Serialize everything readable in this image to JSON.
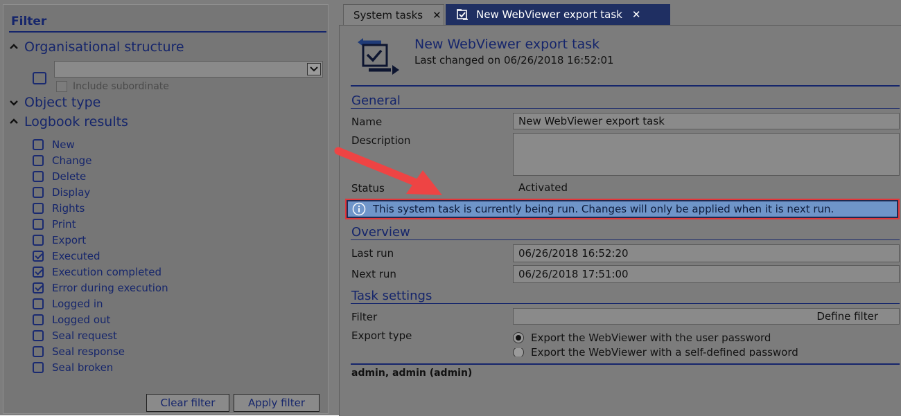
{
  "filter": {
    "title": "Filter",
    "org_structure": {
      "label": "Organisational structure",
      "include_subordinate": "Include subordinate"
    },
    "object_type": {
      "label": "Object type"
    },
    "logbook": {
      "label": "Logbook results",
      "items": [
        {
          "label": "New",
          "checked": false
        },
        {
          "label": "Change",
          "checked": false
        },
        {
          "label": "Delete",
          "checked": false
        },
        {
          "label": "Display",
          "checked": false
        },
        {
          "label": "Rights",
          "checked": false
        },
        {
          "label": "Print",
          "checked": false
        },
        {
          "label": "Export",
          "checked": false
        },
        {
          "label": "Executed",
          "checked": true
        },
        {
          "label": "Execution completed",
          "checked": true
        },
        {
          "label": "Error during execution",
          "checked": true
        },
        {
          "label": "Logged in",
          "checked": false
        },
        {
          "label": "Logged out",
          "checked": false
        },
        {
          "label": "Seal request",
          "checked": false
        },
        {
          "label": "Seal response",
          "checked": false
        },
        {
          "label": "Seal broken",
          "checked": false
        }
      ]
    },
    "clear_label": "Clear filter",
    "apply_label": "Apply filter"
  },
  "tabs": [
    {
      "label": "System tasks",
      "close": "✕"
    },
    {
      "label": "New WebViewer export task",
      "close": "✕"
    }
  ],
  "task": {
    "title": "New WebViewer export task",
    "last_changed": "Last changed on 06/26/2018 16:52:01"
  },
  "general": {
    "title": "General",
    "name_label": "Name",
    "name_value": "New WebViewer export task",
    "description_label": "Description",
    "description_value": "",
    "status_label": "Status",
    "status_value": "Activated",
    "info_message": "This system task is currently being run. Changes will only be applied when it is next run."
  },
  "overview": {
    "title": "Overview",
    "last_run_label": "Last run",
    "last_run_value": "06/26/2018 16:52:20",
    "next_run_label": "Next run",
    "next_run_value": "06/26/2018 17:51:00"
  },
  "task_settings": {
    "title": "Task settings",
    "filter_label": "Filter",
    "define_filter": "Define filter",
    "export_type_label": "Export type",
    "option_user_password": "Export the WebViewer with the user password",
    "option_self_defined": "Export the WebViewer with a self-defined password"
  },
  "footer": {
    "user": "admin, admin (admin)"
  },
  "colors": {
    "accent": "#15256b",
    "active_tab": "#1f2f62",
    "info_bar": "#6f95c9",
    "highlight": "#e2363a"
  }
}
